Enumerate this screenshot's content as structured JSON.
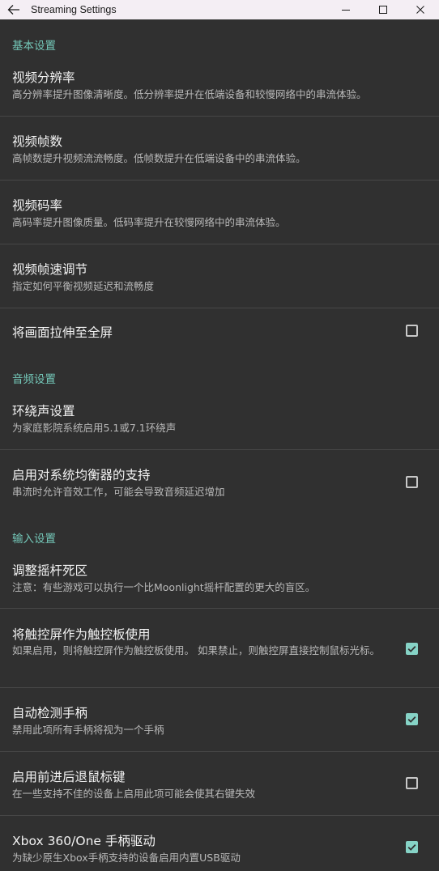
{
  "window": {
    "title": "Streaming Settings"
  },
  "sections": {
    "basic": "基本设置",
    "audio": "音频设置",
    "input": "输入设置"
  },
  "prefs": [
    {
      "title": "视频分辨率",
      "summary": "高分辨率提升图像清晰度。低分辨率提升在低端设备和较慢网络中的串流体验。"
    },
    {
      "title": "视频帧数",
      "summary": "高帧数提升视频流流畅度。低帧数提升在低端设备中的串流体验。"
    },
    {
      "title": "视频码率",
      "summary": "高码率提升图像质量。低码率提升在较慢网络中的串流体验。"
    },
    {
      "title": "视频帧速调节",
      "summary": "指定如何平衡视频延迟和流畅度"
    },
    {
      "title": "将画面拉伸至全屏",
      "checked": false
    },
    {
      "title": "环绕声设置",
      "summary": "为家庭影院系统启用5.1或7.1环绕声"
    },
    {
      "title": "启用对系统均衡器的支持",
      "summary": "串流时允许音效工作，可能会导致音频延迟增加",
      "checked": false
    },
    {
      "title": "调整摇杆死区",
      "summary": "注意：有些游戏可以执行一个比Moonlight摇杆配置的更大的盲区。"
    },
    {
      "title": "将触控屏作为触控板使用",
      "summary": "如果启用，则将触控屏作为触控板使用。 如果禁止，则触控屏直接控制鼠标光标。",
      "checked": true
    },
    {
      "title": "自动检测手柄",
      "summary": "禁用此项所有手柄将视为一个手柄",
      "checked": true
    },
    {
      "title": "启用前进后退鼠标键",
      "summary": "在一些支持不佳的设备上启用此项可能会使其右键失效",
      "checked": false
    },
    {
      "title": "Xbox 360/One 手柄驱动",
      "summary": "为缺少原生Xbox手柄支持的设备启用内置USB驱动",
      "checked": true
    }
  ],
  "colors": {
    "background": "#303030",
    "accent": "#74c8b9",
    "checkbox_checked": "#86d3c6",
    "titlebar": "#f4eef4"
  },
  "icons": {
    "back": "arrow-left-icon",
    "minimize": "minimize-icon",
    "maximize": "maximize-icon",
    "close": "close-icon",
    "check": "checkmark-icon"
  }
}
